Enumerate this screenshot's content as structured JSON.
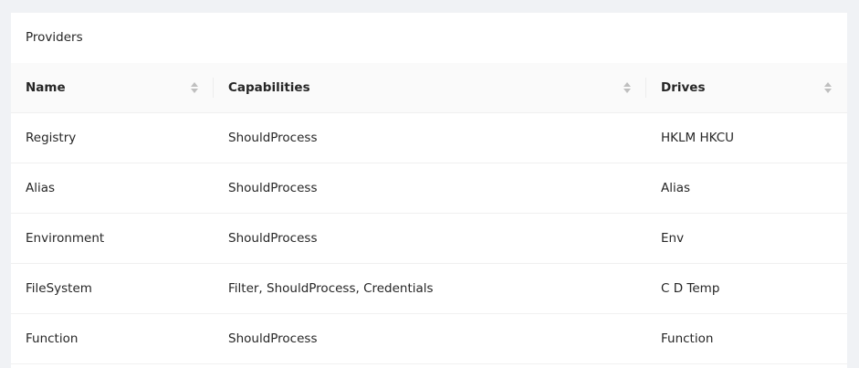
{
  "card": {
    "title": "Providers"
  },
  "table": {
    "columns": [
      {
        "label": "Name"
      },
      {
        "label": "Capabilities"
      },
      {
        "label": "Drives"
      }
    ],
    "rows": [
      {
        "name": "Registry",
        "capabilities": "ShouldProcess",
        "drives": "HKLM HKCU"
      },
      {
        "name": "Alias",
        "capabilities": "ShouldProcess",
        "drives": "Alias"
      },
      {
        "name": "Environment",
        "capabilities": "ShouldProcess",
        "drives": "Env"
      },
      {
        "name": "FileSystem",
        "capabilities": "Filter, ShouldProcess, Credentials",
        "drives": "C D Temp"
      },
      {
        "name": "Function",
        "capabilities": "ShouldProcess",
        "drives": "Function"
      }
    ]
  },
  "icons": {
    "sort": "sort-caret-icon"
  }
}
